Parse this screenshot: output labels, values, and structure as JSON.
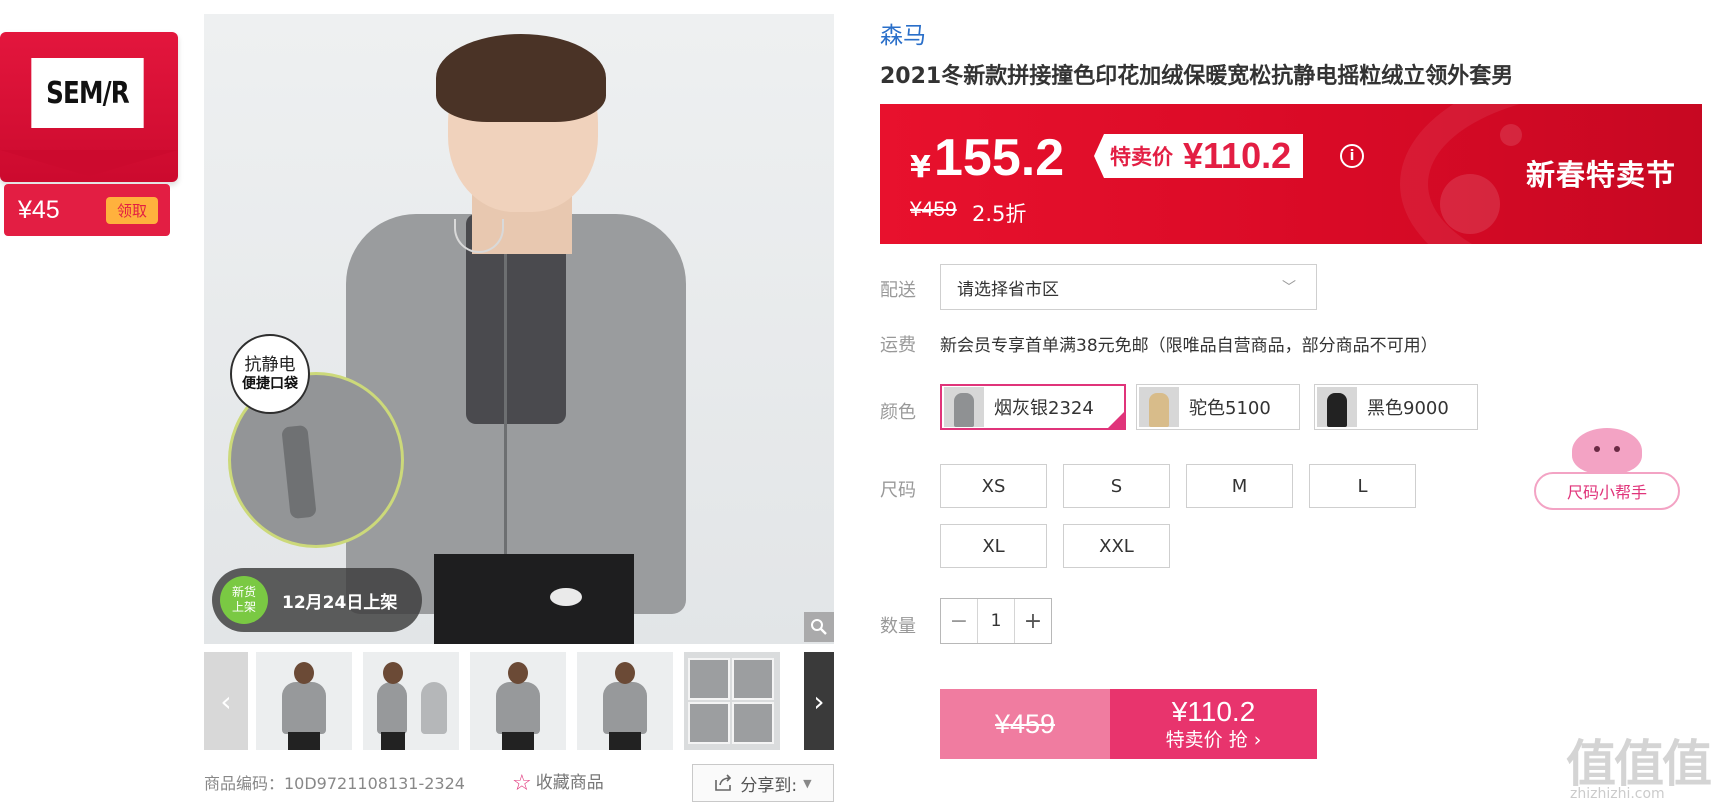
{
  "brand_coupon": {
    "logo_text": "SEM/R",
    "amount": "¥45",
    "get_label": "领取"
  },
  "gallery": {
    "badge_line1": "抗静电",
    "badge_line2": "便捷口袋",
    "new_badge_line1": "新货",
    "new_badge_line2": "上架",
    "new_date": "12月24日上架",
    "zoom_icon": "magnifier-icon",
    "prev_icon": "chevron-left-icon",
    "next_icon": "chevron-right-icon"
  },
  "product_code_label": "商品编码：10D9721108131-2324",
  "favorite_label": "收藏商品",
  "share_label": "分享到:",
  "brand": "森马",
  "title": "2021冬新款拼接撞色印花加绒保暖宽松抗静电摇粒绒立领外套男",
  "price": {
    "currency": "¥",
    "current": "155.2",
    "special_label": "特卖价",
    "special_price": "¥110.2",
    "original": "¥459",
    "discount": "2.5折",
    "festival": "新春特卖节",
    "banner_color": "#e31e43"
  },
  "delivery": {
    "label": "配送",
    "placeholder": "请选择省市区"
  },
  "shipping": {
    "label": "运费",
    "text": "新会员专享首单满38元免邮（限唯品自营商品，部分商品不可用）"
  },
  "colors": {
    "label": "颜色",
    "options": [
      {
        "name": "烟灰银2324",
        "selected": true
      },
      {
        "name": "驼色5100",
        "selected": false
      },
      {
        "name": "黑色9000",
        "selected": false
      }
    ]
  },
  "sizes": {
    "label": "尺码",
    "options": [
      "XS",
      "S",
      "M",
      "L",
      "XL",
      "XXL"
    ]
  },
  "size_helper": "尺码小帮手",
  "quantity": {
    "label": "数量",
    "value": "1",
    "minus": "−",
    "plus": "+"
  },
  "buy": {
    "original": "¥459",
    "price": "¥110.2",
    "action": "特卖价 抢 ›"
  },
  "watermark": {
    "text": "值值值",
    "url": "zhizhizhi.com"
  },
  "accent_color": "#e0347a"
}
